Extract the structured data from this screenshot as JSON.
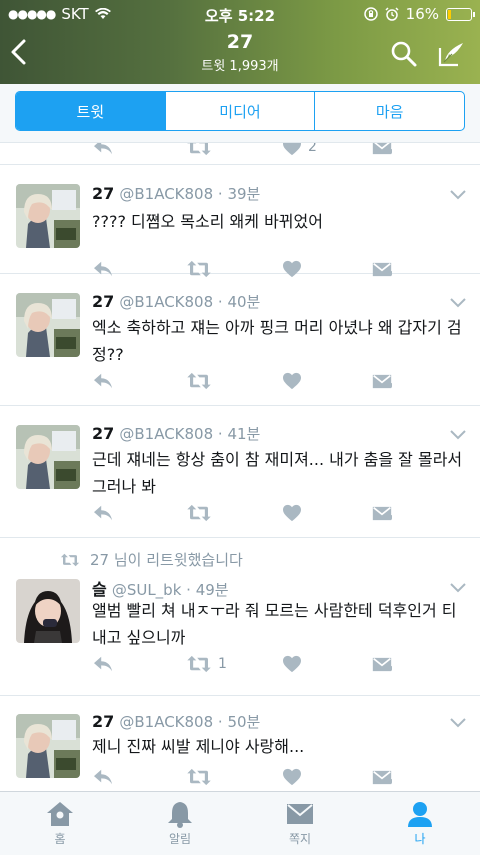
{
  "status_bar": {
    "carrier": "SKT",
    "time": "오후 5:22",
    "battery": "16%",
    "battery_level": 0.16
  },
  "header": {
    "title": "27",
    "subtitle": "트윗 1,993개"
  },
  "tabs": [
    {
      "label": "트윗",
      "active": true
    },
    {
      "label": "미디어",
      "active": false
    },
    {
      "label": "마음",
      "active": false
    }
  ],
  "partial_tweet": {
    "like_count": "2"
  },
  "tweets": [
    {
      "name": "27",
      "handle": "@B1ACK808",
      "time": "39분",
      "text": "???? 디쪔오 목소리 왜케 바뀌었어"
    },
    {
      "name": "27",
      "handle": "@B1ACK808",
      "time": "40분",
      "text": "엑소 축하하고 쟤는 아까 핑크 머리 아녔냐 왜 갑자기 검정??"
    },
    {
      "name": "27",
      "handle": "@B1ACK808",
      "time": "41분",
      "text": "근데 쟤네는 항상 춤이 참 재미져... 내가 춤을 잘 몰라서 그러나 봐"
    },
    {
      "retweet_note": "27 님이 리트윗했습니다",
      "name": "슬",
      "handle": "@SUL_bk",
      "time": "49분",
      "text": "앨범 빨리 쳐 내ㅈㅜ라 줘 모르는 사람한테 덕후인거 티내고 싶으니까",
      "retweet_count": "1"
    },
    {
      "name": "27",
      "handle": "@B1ACK808",
      "time": "50분",
      "text": "제니 진짜 씨발 제니야 사랑해..."
    }
  ],
  "bottom_nav": [
    {
      "label": "홈",
      "icon": "home-icon",
      "active": false
    },
    {
      "label": "알림",
      "icon": "bell-icon",
      "active": false
    },
    {
      "label": "쪽지",
      "icon": "envelope-icon",
      "active": false
    },
    {
      "label": "나",
      "icon": "person-icon",
      "active": true
    }
  ],
  "colors": {
    "accent": "#1da1f2",
    "icon_gray": "#aab8c2",
    "meta_gray": "#8899a6",
    "header_green": "#6f8c42"
  }
}
